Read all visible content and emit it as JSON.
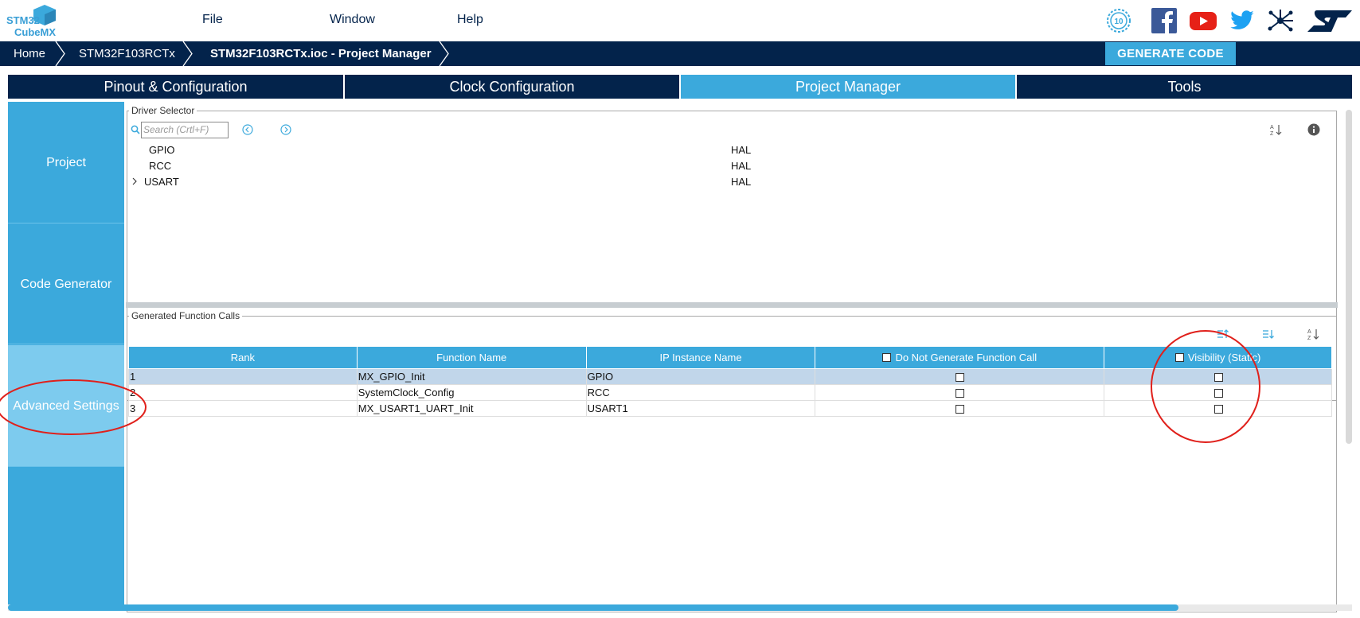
{
  "app": {
    "logo_line1": "STM32",
    "logo_line2": "CubeMX"
  },
  "menu": {
    "file": "File",
    "window": "Window",
    "help": "Help"
  },
  "social_icons": [
    "anniversary-10-icon",
    "facebook-icon",
    "youtube-icon",
    "twitter-icon",
    "network-icon",
    "st-logo-icon"
  ],
  "breadcrumb": {
    "home": "Home",
    "device": "STM32F103RCTx",
    "current": "STM32F103RCTx.ioc - Project Manager"
  },
  "generate_button": "GENERATE CODE",
  "tabs": [
    {
      "label": "Pinout & Configuration",
      "active": false
    },
    {
      "label": "Clock Configuration",
      "active": false
    },
    {
      "label": "Project Manager",
      "active": true
    },
    {
      "label": "Tools",
      "active": false
    }
  ],
  "side_menu": [
    {
      "label": "Project",
      "active": false
    },
    {
      "label": "Code Generator",
      "active": false
    },
    {
      "label": "Advanced Settings",
      "active": true
    }
  ],
  "driver_selector": {
    "legend": "Driver Selector",
    "search_placeholder": "Search (Crtl+F)",
    "rows": [
      {
        "name": "GPIO",
        "driver": "HAL",
        "expandable": false
      },
      {
        "name": "RCC",
        "driver": "HAL",
        "expandable": false
      },
      {
        "name": "USART",
        "driver": "HAL",
        "expandable": true
      }
    ]
  },
  "function_calls": {
    "legend": "Generated Function Calls",
    "columns": [
      "Rank",
      "Function Name",
      "IP Instance Name",
      "Do Not Generate Function Call",
      "Visibility (Static)"
    ],
    "rows": [
      {
        "rank": "1",
        "function": "MX_GPIO_Init",
        "instance": "GPIO",
        "do_not_generate": false,
        "visibility_static": false,
        "selected": true
      },
      {
        "rank": "2",
        "function": "SystemClock_Config",
        "instance": "RCC",
        "do_not_generate": false,
        "visibility_static": false,
        "selected": false
      },
      {
        "rank": "3",
        "function": "MX_USART1_UART_Init",
        "instance": "USART1",
        "do_not_generate": false,
        "visibility_static": false,
        "selected": false
      }
    ]
  },
  "colors": {
    "navy": "#03234b",
    "accent": "#3ba9dc",
    "highlight_circle": "#e0201b"
  }
}
